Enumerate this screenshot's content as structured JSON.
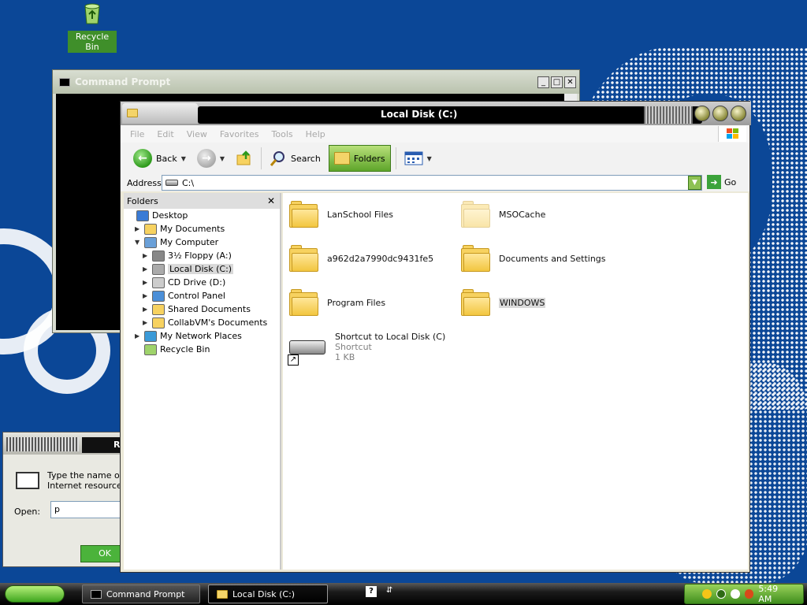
{
  "desktop": {
    "icons": [
      {
        "label": "Recycle Bin",
        "icon": "recycle-bin-icon"
      }
    ]
  },
  "cmd_window": {
    "title": "Command Prompt",
    "controls": [
      "_",
      "□",
      "✕"
    ]
  },
  "run_dialog": {
    "title_fragment": "R",
    "description_line1": "Type the name of a",
    "description_line2": "Internet resource,",
    "open_label": "Open:",
    "open_value": "p",
    "ok_label": "OK"
  },
  "explorer": {
    "title": "Local Disk (C:)",
    "menu": [
      "File",
      "Edit",
      "View",
      "Favorites",
      "Tools",
      "Help"
    ],
    "toolbar": {
      "back_label": "Back",
      "search_label": "Search",
      "folders_label": "Folders"
    },
    "address": {
      "label": "Address",
      "value": "C:\\",
      "go_label": "Go"
    },
    "folders_pane": {
      "header": "Folders",
      "close": "✕",
      "tree": [
        {
          "label": "Desktop",
          "level": 0,
          "expander": "",
          "icon": "desktop-icon"
        },
        {
          "label": "My Documents",
          "level": 1,
          "expander": "▶",
          "icon": "my-documents-icon"
        },
        {
          "label": "My Computer",
          "level": 1,
          "expander": "▼",
          "icon": "my-computer-icon"
        },
        {
          "label": "3½ Floppy (A:)",
          "level": 2,
          "expander": "▶",
          "icon": "floppy-icon"
        },
        {
          "label": "Local Disk (C:)",
          "level": 2,
          "expander": "▶",
          "icon": "hard-disk-icon",
          "selected": true
        },
        {
          "label": "CD Drive (D:)",
          "level": 2,
          "expander": "▶",
          "icon": "cd-drive-icon"
        },
        {
          "label": "Control Panel",
          "level": 2,
          "expander": "▶",
          "icon": "control-panel-icon"
        },
        {
          "label": "Shared Documents",
          "level": 2,
          "expander": "▶",
          "icon": "folder-icon"
        },
        {
          "label": "CollabVM's Documents",
          "level": 2,
          "expander": "▶",
          "icon": "folder-icon"
        },
        {
          "label": "My Network Places",
          "level": 1,
          "expander": "▶",
          "icon": "network-places-icon"
        },
        {
          "label": "Recycle Bin",
          "level": 1,
          "expander": "",
          "icon": "recycle-bin-icon"
        }
      ]
    },
    "items": [
      {
        "name": "LanSchool Files",
        "type": "folder"
      },
      {
        "name": "MSOCache",
        "type": "folder-hidden"
      },
      {
        "name": "a962d2a7990dc9431fe5",
        "type": "folder"
      },
      {
        "name": "Documents and Settings",
        "type": "folder"
      },
      {
        "name": "Program Files",
        "type": "folder"
      },
      {
        "name": "WINDOWS",
        "type": "folder",
        "highlighted": true
      },
      {
        "name": "Shortcut to Local Disk (C)",
        "type": "shortcut",
        "kind": "Shortcut",
        "size": "1 KB"
      }
    ]
  },
  "taskbar": {
    "tasks": [
      {
        "label": "Command Prompt",
        "icon": "cmd-icon"
      },
      {
        "label": "Local Disk (C:)",
        "icon": "folder-icon",
        "active": true
      }
    ],
    "clock": "5:49 AM"
  },
  "colors": {
    "desktop_blue": "#0b4797",
    "accent_green": "#3f8e1d",
    "folder_yellow": "#f7d260"
  }
}
